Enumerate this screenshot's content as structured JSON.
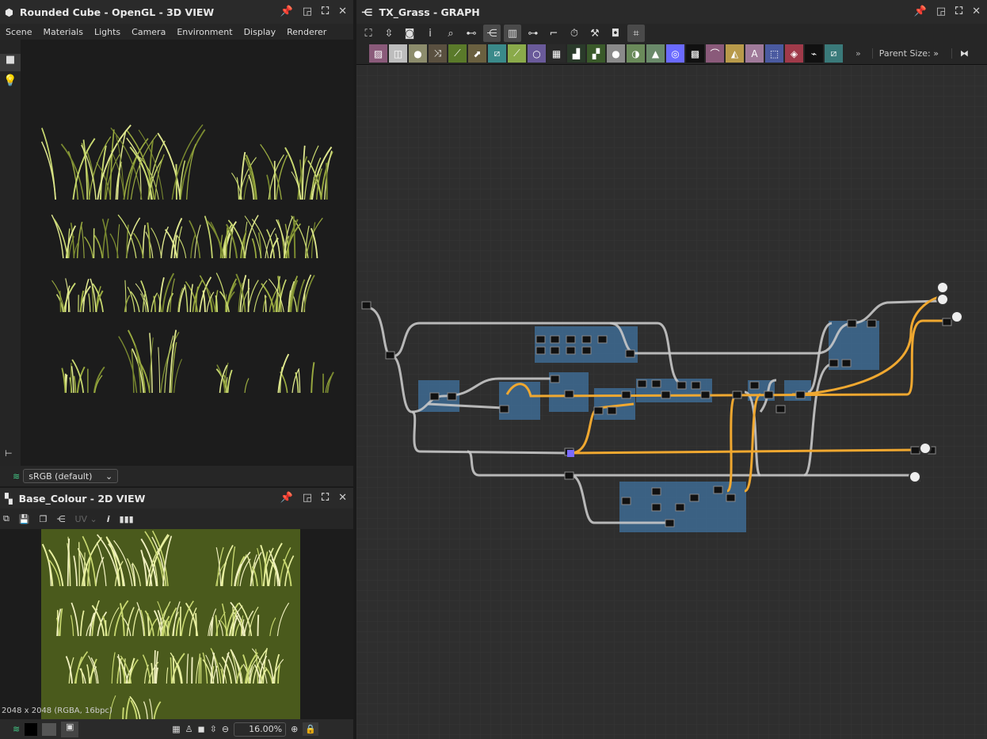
{
  "view3d": {
    "title": "Rounded Cube - OpenGL - 3D VIEW",
    "menu": [
      "Scene",
      "Materials",
      "Lights",
      "Camera",
      "Environment",
      "Display",
      "Renderer"
    ],
    "colorspace": "sRGB (default)"
  },
  "view2d": {
    "title": "Base_Colour - 2D VIEW",
    "uv_label": "UV",
    "info": "2048 x 2048 (RGBA, 16bpc)",
    "zoom": "16.00%",
    "image_color": "#4a5a1c"
  },
  "graph": {
    "title": "TX_Grass - GRAPH",
    "parent_size_label": "Parent Size:",
    "more": "»",
    "toolbar1": [
      {
        "icon": "frame-all-icon",
        "g": "⛶"
      },
      {
        "icon": "reset-zoom-icon",
        "g": "⇳"
      },
      {
        "icon": "camera-icon",
        "g": "◙"
      },
      {
        "icon": "info-icon",
        "g": "i"
      },
      {
        "icon": "search-icon",
        "g": "⌕"
      },
      {
        "icon": "align-icon",
        "g": "⊷"
      },
      {
        "icon": "graph-layout-icon",
        "g": "⋲",
        "on": true
      },
      {
        "icon": "frame-icon",
        "g": "▥",
        "on": true
      },
      {
        "icon": "link-icon",
        "g": "⊶"
      },
      {
        "icon": "connector-icon",
        "g": "⌐"
      },
      {
        "icon": "timer-icon",
        "g": "⏱"
      },
      {
        "icon": "tools-icon",
        "g": "⚒"
      },
      {
        "icon": "preview-icon",
        "g": "◘"
      },
      {
        "icon": "snap-icon",
        "g": "⌗",
        "on": true
      }
    ],
    "nodes": [
      {
        "icon": "bitmap-icon",
        "c": "#8a5a7a",
        "g": "▨"
      },
      {
        "icon": "blend-icon",
        "c": "#bdbdbd",
        "g": "◫"
      },
      {
        "icon": "drop-icon",
        "c": "#8c8c6c",
        "g": "●"
      },
      {
        "icon": "shuffle-icon",
        "c": "#5a5040",
        "g": "⤨"
      },
      {
        "icon": "curve-icon",
        "c": "#5a7a2a",
        "g": "⟋"
      },
      {
        "icon": "levels-icon",
        "c": "#6a6040",
        "g": "⬈"
      },
      {
        "icon": "warp-icon",
        "c": "#3a8a8a",
        "g": "⧄"
      },
      {
        "icon": "gradient-icon",
        "c": "#8aaa4a",
        "g": "⟋"
      },
      {
        "icon": "circle-icon",
        "c": "#6a5a9a",
        "g": "○"
      },
      {
        "icon": "tile-icon",
        "c": "#2a2a2a",
        "g": "▦"
      },
      {
        "icon": "height-icon",
        "c": "#2a3a2a",
        "g": "▟"
      },
      {
        "icon": "gradient-map-icon",
        "c": "#3a5a2a",
        "g": "▞"
      },
      {
        "icon": "node-link-icon",
        "c": "#8a8a8a",
        "g": "●"
      },
      {
        "icon": "grayscale-icon",
        "c": "#6a8a5a",
        "g": "◑"
      },
      {
        "icon": "histogram-icon",
        "c": "#6a8a6a",
        "g": "▲"
      },
      {
        "icon": "hsl-icon",
        "c": "#6a6aff",
        "g": "◎"
      },
      {
        "icon": "noise-icon",
        "c": "#111111",
        "g": "▩"
      },
      {
        "icon": "spline-icon",
        "c": "#8a5a7a",
        "g": "⌒"
      },
      {
        "icon": "mirror-icon",
        "c": "#b89a4a",
        "g": "◭"
      },
      {
        "icon": "text-icon",
        "c": "#a07a9a",
        "g": "A"
      },
      {
        "icon": "transform-icon",
        "c": "#4a5aa0",
        "g": "⬚"
      },
      {
        "icon": "fill-icon",
        "c": "#a03a4a",
        "g": "◈"
      },
      {
        "icon": "fx-map-icon",
        "c": "#111111",
        "g": "⌁"
      },
      {
        "icon": "pattern-icon",
        "c": "#3a7a7a",
        "g": "⧄"
      }
    ]
  },
  "colors": {
    "wire": "#c8c8c8",
    "wire_active": "#f0a830",
    "frame": "#3d6a92",
    "canvas": "#2e2e2e"
  }
}
